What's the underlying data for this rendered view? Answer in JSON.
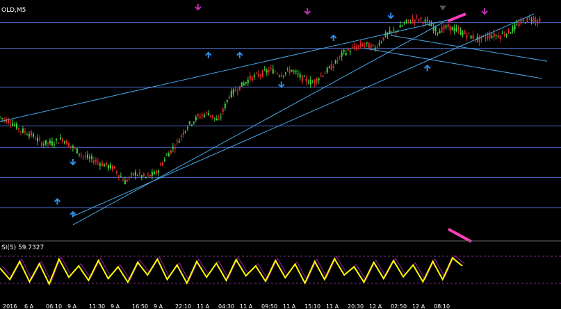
{
  "window": {
    "symbol_label": "OLD,M5"
  },
  "indicator": {
    "label": "SI(5) 59.7327",
    "level_high": 70,
    "level_low": 30,
    "color": "#ffff00",
    "secondary_color": "#9b1b9b"
  },
  "colors": {
    "background": "#000000",
    "bull_candle": "#39d839",
    "bear_candle": "#e02a2a",
    "horizontal_lines": "#4f6bc8",
    "trend_lines": "#46a8e8",
    "arrow_blue": "#2d8fe6",
    "arrow_magenta": "#c32db5",
    "marker_pink": "#ff3dbd"
  },
  "time_axis": {
    "ticks": [
      "2016",
      "6 A",
      "06:10",
      "9 A",
      "11:30",
      "9 A",
      "16:50",
      "9 A",
      "22:10",
      "11 A",
      "04:30",
      "11 A",
      "09:50",
      "11 A",
      "15:10",
      "11 A",
      "20:30",
      "12 A",
      "02:50",
      "12 A",
      "08:10"
    ]
  },
  "chart_data": {
    "type": "candlestick",
    "description_series": "price path of candles (relative price units read visually)",
    "ylim": [
      0,
      100
    ],
    "grid": false,
    "price_path": [
      [
        0,
        52
      ],
      [
        4,
        50
      ],
      [
        8,
        46
      ],
      [
        12,
        44
      ],
      [
        16,
        40
      ],
      [
        20,
        40
      ],
      [
        24,
        42
      ],
      [
        28,
        38
      ],
      [
        32,
        34
      ],
      [
        36,
        32
      ],
      [
        40,
        30
      ],
      [
        44,
        28
      ],
      [
        48,
        22
      ],
      [
        52,
        26
      ],
      [
        56,
        24
      ],
      [
        60,
        26
      ],
      [
        64,
        34
      ],
      [
        68,
        40
      ],
      [
        72,
        48
      ],
      [
        76,
        52
      ],
      [
        80,
        54
      ],
      [
        84,
        50
      ],
      [
        88,
        62
      ],
      [
        92,
        66
      ],
      [
        96,
        70
      ],
      [
        100,
        72
      ],
      [
        104,
        74
      ],
      [
        108,
        72
      ],
      [
        112,
        74
      ],
      [
        116,
        70
      ],
      [
        120,
        68
      ],
      [
        124,
        72
      ],
      [
        128,
        76
      ],
      [
        132,
        82
      ],
      [
        136,
        84
      ],
      [
        140,
        86
      ],
      [
        144,
        84
      ],
      [
        148,
        90
      ],
      [
        152,
        92
      ],
      [
        156,
        96
      ],
      [
        160,
        98
      ],
      [
        164,
        96
      ],
      [
        168,
        92
      ],
      [
        172,
        94
      ],
      [
        176,
        92
      ],
      [
        180,
        90
      ],
      [
        184,
        88
      ],
      [
        188,
        90
      ],
      [
        192,
        90
      ],
      [
        196,
        92
      ],
      [
        200,
        96
      ],
      [
        204,
        98
      ],
      [
        208,
        96
      ]
    ],
    "horizontal_levels": [
      10,
      24,
      38,
      48,
      66,
      84,
      96
    ],
    "up_arrows": [
      [
        22,
        14
      ],
      [
        28,
        8
      ],
      [
        80,
        82
      ],
      [
        92,
        82
      ],
      [
        128,
        90
      ],
      [
        164,
        76
      ]
    ],
    "down_arrows": [
      [
        28,
        30
      ],
      [
        76,
        102
      ],
      [
        108,
        66
      ],
      [
        118,
        100
      ],
      [
        150,
        98
      ],
      [
        186,
        100
      ]
    ],
    "rsi_values": [
      55,
      30,
      70,
      25,
      65,
      20,
      75,
      35,
      60,
      28,
      72,
      32,
      58,
      24,
      68,
      40,
      75,
      30,
      62,
      22,
      70,
      35,
      66,
      28,
      74,
      38,
      60,
      26,
      72,
      34,
      64,
      22,
      70,
      30,
      76,
      40,
      58,
      24,
      68,
      32,
      72,
      36,
      62,
      25,
      70,
      30,
      78,
      60
    ]
  }
}
